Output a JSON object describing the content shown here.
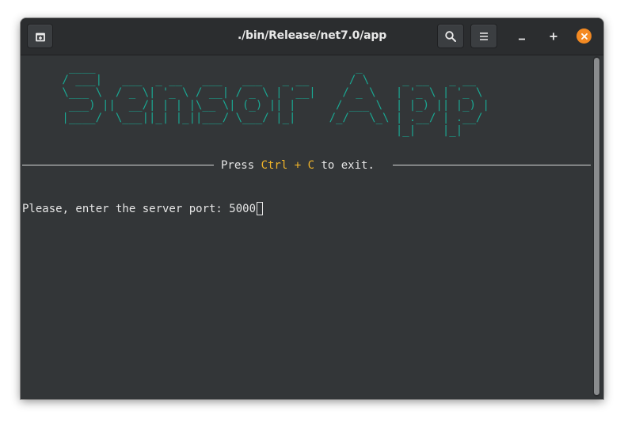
{
  "window": {
    "title": "./bin/Release/net7.0/app"
  },
  "titlebar": {
    "icons": {
      "new_tab": "new-tab-icon",
      "search": "search-icon",
      "menu": "hamburger-menu-icon",
      "minimize": "minimize-icon",
      "maximize": "maximize-icon",
      "close": "close-icon"
    },
    "close_color": "#f48a22"
  },
  "terminal": {
    "banner": {
      "text": "Sensor App",
      "color": "#1aa893",
      "ascii_lines": [
        "  ____                                       _                   ",
        " / ___|   ___  _ __   ___   ___   _ __      / \\     _ __   _ __  ",
        " \\___ \\  / _ \\| '_ \\ / __| / _ \\ | '__|    / _ \\   | '_ \\ | '_ \\ ",
        "  ___) ||  __/| | | |\\__ \\| (_) || |      / ___ \\  | |_) || |_) |",
        " |____/  \\___||_| |_||___/ \\___/ |_|     /_/   \\_\\ | .__/ | .__/ ",
        "                                                   |_|    |_|    "
      ]
    },
    "exit_hint": {
      "prefix": "Press ",
      "key1": "Ctrl",
      "plus": " + ",
      "key2": "C",
      "suffix": " to exit."
    },
    "prompt": {
      "text": "Please, enter the server port: ",
      "input_value": "5000"
    },
    "colors": {
      "background": "#333638",
      "foreground": "#e6e6e6",
      "highlight": "#f0b429"
    }
  }
}
